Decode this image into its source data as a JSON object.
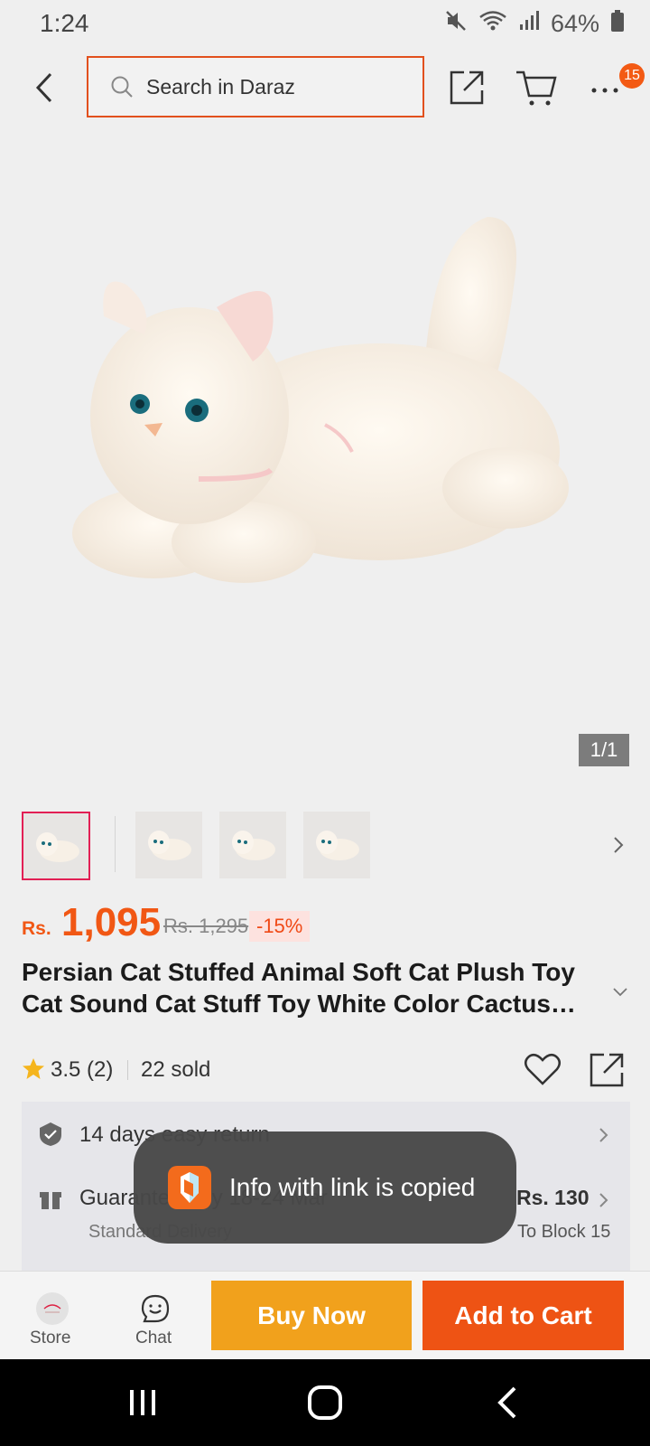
{
  "status_bar": {
    "time": "1:24",
    "battery": "64%"
  },
  "nav": {
    "search_placeholder": "Search in Daraz",
    "cart_badge": "15"
  },
  "gallery": {
    "counter": "1/1",
    "thumbnail_count": 4
  },
  "price": {
    "currency": "Rs.",
    "current": "1,095",
    "original": "Rs. 1,295",
    "discount": "-15%"
  },
  "product": {
    "title": "Persian Cat Stuffed Animal Soft Cat Plush Toy Cat Sound Cat Stuff Toy White Color Cactus…",
    "rating": "3.5 (2)",
    "sold": "22 sold"
  },
  "info": {
    "return_text": "14 days easy return",
    "delivery_text": "Guaranteed by 18-24 Mar",
    "delivery_sub": "Standard Delivery",
    "delivery_price": "Rs. 130",
    "delivery_dest": "To Block 15"
  },
  "toast": {
    "message": "Info with link is copied"
  },
  "actions": {
    "store_label": "Store",
    "chat_label": "Chat",
    "buy_now": "Buy Now",
    "add_to_cart": "Add to Cart"
  },
  "colors": {
    "brand_orange": "#f15714",
    "buy_now": "#f1a11c",
    "add_to_cart": "#ee5314"
  }
}
